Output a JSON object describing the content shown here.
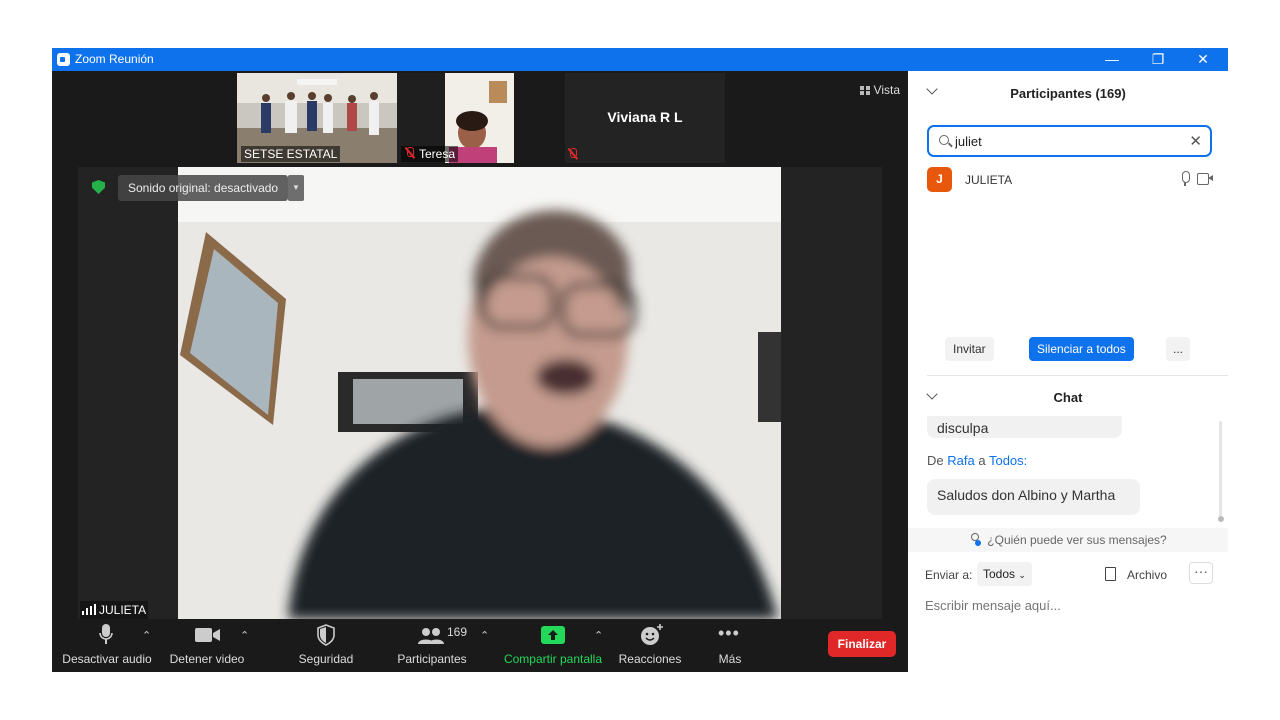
{
  "window": {
    "title": "Zoom Reunión",
    "controls": {
      "minimize": "—",
      "restore": "❐",
      "close": "✕"
    },
    "accent": "#0e72ed"
  },
  "thumbnails": [
    {
      "name": "SETSE ESTATAL",
      "muted": false
    },
    {
      "name": "Teresa",
      "muted": true
    },
    {
      "name": "Viviana R L",
      "muted": true
    }
  ],
  "view_button": {
    "label": "Vista",
    "icon": "grid-icon"
  },
  "main_video": {
    "sound_label": "Sonido original: desactivado",
    "speaker_name": "JULIETA"
  },
  "toolbar": {
    "audio_label": "Desactivar audio",
    "video_label": "Detener video",
    "security_label": "Seguridad",
    "participants_label": "Participantes",
    "participants_count": "169",
    "share_label": "Compartir pantalla",
    "reactions_label": "Reacciones",
    "more_label": "Más",
    "end_label": "Finalizar",
    "end_color": "#e02828",
    "share_color": "#23d959"
  },
  "participants_panel": {
    "title": "Participantes (169)",
    "search_value": "juliet",
    "results": [
      {
        "initial": "J",
        "name": "JULIETA",
        "avatar_color": "#e8580c"
      }
    ],
    "buttons": {
      "invite": "Invitar",
      "mute_all": "Silenciar a todos",
      "more": "..."
    }
  },
  "chat_panel": {
    "title": "Chat",
    "partial_message": "disculpa",
    "message_meta": {
      "prefix": "De",
      "sender": "Rafa",
      "middle": "a",
      "recipient": "Todos:"
    },
    "message_text": "Saludos don Albino y Martha",
    "who_can_see": "¿Quién puede ver sus mensajes?",
    "send_to_label": "Enviar a:",
    "send_to_value": "Todos",
    "file_label": "Archivo",
    "more_label": "···",
    "input_placeholder": "Escribir mensaje aquí..."
  }
}
